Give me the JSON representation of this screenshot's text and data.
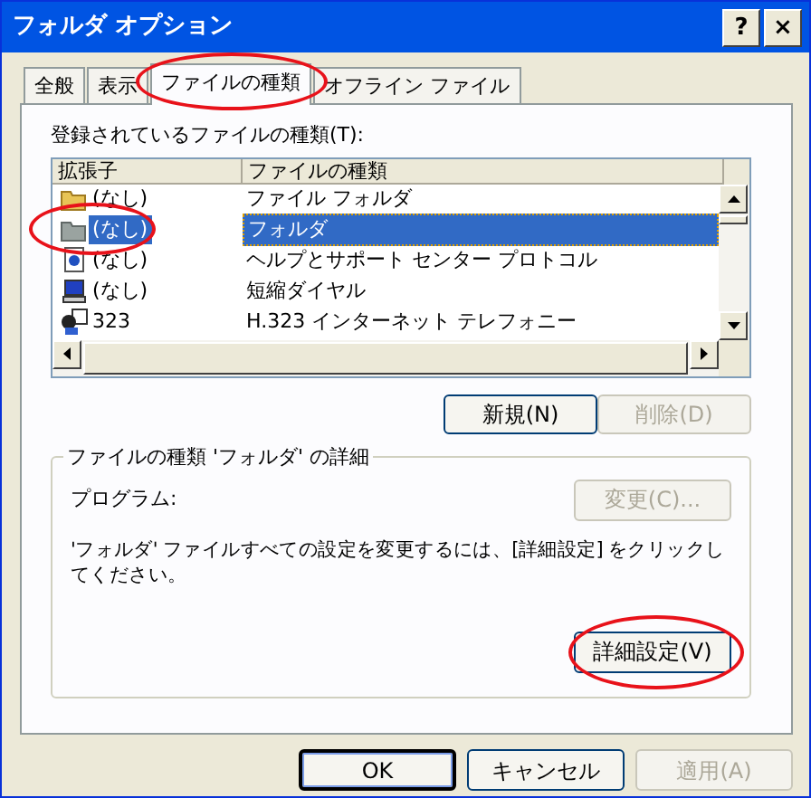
{
  "window": {
    "title": "フォルダ オプション",
    "help_button": "?",
    "close_button": "×"
  },
  "tabs": [
    {
      "label": "全般",
      "selected": false,
      "circled": false
    },
    {
      "label": "表示",
      "selected": false,
      "circled": false
    },
    {
      "label": "ファイルの種類",
      "selected": true,
      "circled": true
    },
    {
      "label": "オフライン ファイル",
      "selected": false,
      "circled": false
    }
  ],
  "list_label": "登録されているファイルの種類(T):",
  "table": {
    "columns": [
      "拡張子",
      "ファイルの種類"
    ],
    "rows": [
      {
        "kind": "folder",
        "extension": "(なし)",
        "type": "ファイル フォルダ",
        "selected": false,
        "circled": false
      },
      {
        "kind": "grey-folder",
        "extension": "(なし)",
        "type": "フォルダ",
        "selected": true,
        "circled": true
      },
      {
        "kind": "help",
        "extension": "(なし)",
        "type": "ヘルプとサポート センター プロトコル",
        "selected": false,
        "circled": false
      },
      {
        "kind": "computer",
        "extension": "(なし)",
        "type": "短縮ダイヤル",
        "selected": false,
        "circled": false
      },
      {
        "kind": "phone",
        "extension": "323",
        "type": "H.323 インターネット テレフォニー",
        "selected": false,
        "circled": false
      }
    ]
  },
  "list_buttons": [
    {
      "label": "新規(N)",
      "disabled": false
    },
    {
      "label": "削除(D)",
      "disabled": true
    }
  ],
  "details": {
    "legend": "ファイルの種類 'フォルダ' の詳細",
    "program_label": "プログラム:",
    "change_button": {
      "label": "変更(C)...",
      "disabled": true
    },
    "description": "'フォルダ' ファイルすべての設定を変更するには、[詳細設定] をクリックしてください。",
    "advanced_button": {
      "label": "詳細設定(V)",
      "disabled": false,
      "circled": true
    }
  },
  "footer_buttons": [
    {
      "label": "OK",
      "disabled": false,
      "default": true
    },
    {
      "label": "キャンセル",
      "disabled": false,
      "default": false
    },
    {
      "label": "適用(A)",
      "disabled": true,
      "default": false
    }
  ]
}
